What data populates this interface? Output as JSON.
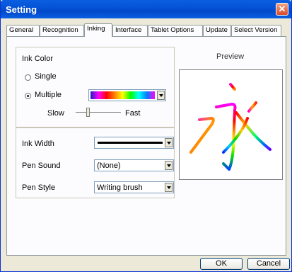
{
  "window": {
    "title": "Setting"
  },
  "tabs": [
    {
      "label": "General"
    },
    {
      "label": "Recognition"
    },
    {
      "label": "Inking"
    },
    {
      "label": "Interface"
    },
    {
      "label": "Tablet Options"
    },
    {
      "label": "Update"
    },
    {
      "label": "Select Version"
    }
  ],
  "active_tab": "Inking",
  "ink_color": {
    "group_label": "Ink Color",
    "single_label": "Single",
    "multiple_label": "Multiple",
    "selected": "Multiple",
    "speed_slow_label": "Slow",
    "speed_fast_label": "Fast"
  },
  "ink_width": {
    "label": "Ink Width"
  },
  "pen_sound": {
    "label": "Pen Sound",
    "value": "(None)"
  },
  "pen_style": {
    "label": "Pen Style",
    "value": "Writing brush"
  },
  "preview": {
    "label": "Preview"
  },
  "buttons": {
    "ok": "OK",
    "cancel": "Cancel"
  }
}
